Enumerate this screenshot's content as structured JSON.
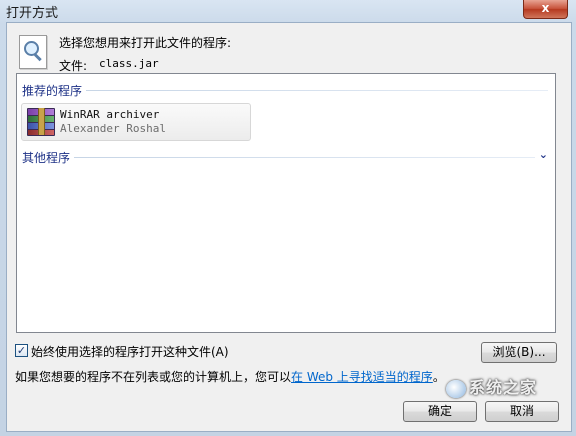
{
  "window": {
    "title": "打开方式",
    "close_label": "x"
  },
  "header": {
    "prompt": "选择您想用来打开此文件的程序:",
    "file_label": "文件:",
    "file_name": "class.jar"
  },
  "program_list": {
    "recommended_label": "推荐的程序",
    "programs": [
      {
        "name": "WinRAR archiver",
        "vendor": "Alexander Roshal",
        "icon": "winrar-icon"
      }
    ],
    "other_label": "其他程序",
    "other_chevron": "⌄"
  },
  "options": {
    "always_use_checked": true,
    "always_use_mark": "✓",
    "always_use_label": "始终使用选择的程序打开这种文件(A)"
  },
  "buttons": {
    "browse": "浏览(B)...",
    "ok": "确定",
    "cancel": "取消"
  },
  "info": {
    "prefix": "如果您想要的程序不在列表或您的计算机上，您可以",
    "link": "在 Web 上寻找适当的程序",
    "suffix": "。"
  },
  "watermark": {
    "text": "系统之家"
  }
}
